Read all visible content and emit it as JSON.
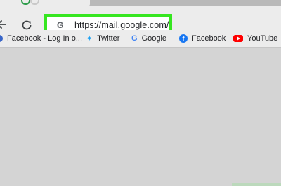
{
  "browser": {
    "address_bar": {
      "url": "https://mail.google.com/",
      "site_icon": "google-g-icon",
      "highlight_color": "#36e620"
    },
    "toolbar": {
      "back_icon": "back-arrow-icon",
      "reload_icon": "reload-icon"
    },
    "bookmarks": [
      {
        "label": "Facebook - Log In o...",
        "icon": "globe-icon"
      },
      {
        "label": "Twitter",
        "icon": "twitter-icon"
      },
      {
        "label": "Google",
        "icon": "google-g-icon"
      },
      {
        "label": "Facebook",
        "icon": "facebook-icon"
      },
      {
        "label": "YouTube",
        "icon": "youtube-icon"
      }
    ]
  }
}
